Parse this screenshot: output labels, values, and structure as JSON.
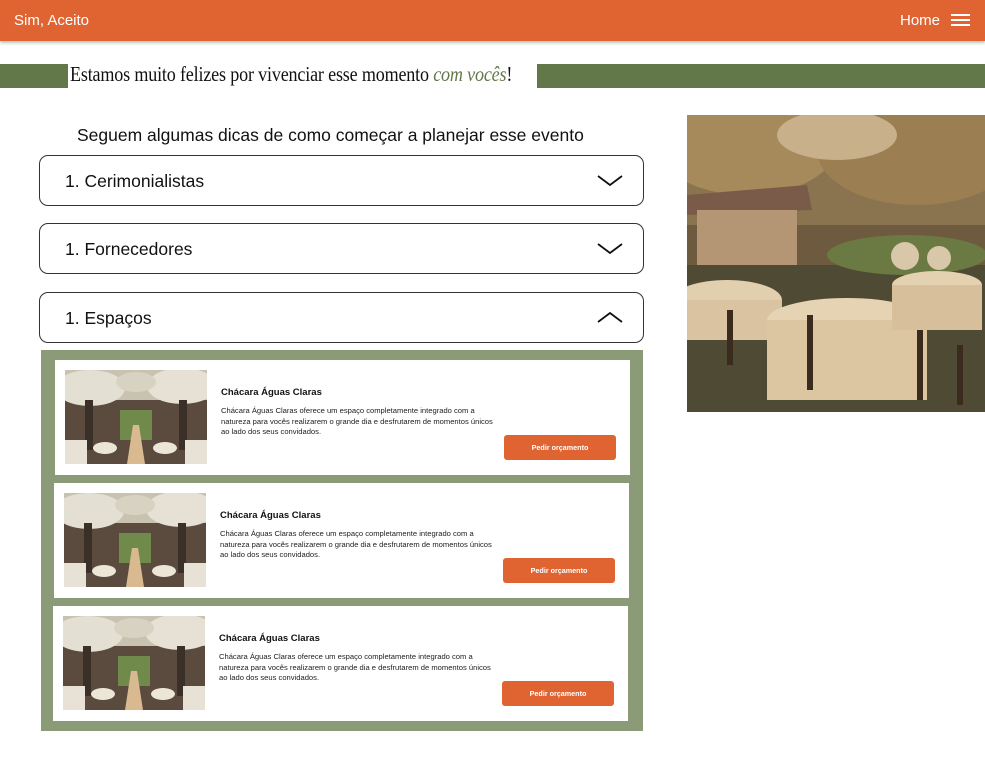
{
  "header": {
    "brand": "Sim, Aceito",
    "nav_home": "Home"
  },
  "hero": {
    "headline_main": "Estamos muito felizes por vivenciar esse momento ",
    "headline_accent": "com vocês",
    "headline_end": "!"
  },
  "intro": "Seguem algumas dicas de como começar a planejar esse evento",
  "accordions": [
    {
      "label": "1. Cerimonialistas",
      "state": "collapsed"
    },
    {
      "label": "1. Fornecedores",
      "state": "collapsed"
    },
    {
      "label": "1. Espaços",
      "state": "expanded"
    }
  ],
  "venues": [
    {
      "title": "Chácara Águas Claras",
      "description": "Chácara Águas Claras oferece um espaço completamente integrado com a natureza para vocês realizarem o grande dia e desfrutarem de momentos únicos ao lado dos seus convidados.",
      "button": "Pedir orçamento"
    },
    {
      "title": "Chácara Águas Claras",
      "description": "Chácara Águas Claras oferece um espaço completamente integrado com a natureza para vocês realizarem o grande dia e desfrutarem de momentos únicos ao lado dos seus convidados.",
      "button": "Pedir orçamento"
    },
    {
      "title": "Chácara Águas Claras",
      "description": "Chácara Águas Claras oferece um espaço completamente integrado com a natureza para vocês realizarem o grande dia e desfrutarem de momentos únicos ao lado dos seus convidados.",
      "button": "Pedir orçamento"
    }
  ],
  "colors": {
    "accent_orange": "#e06432",
    "olive": "#637849",
    "sage_panel": "#8b9a77"
  },
  "icons": {
    "menu": "hamburger-icon",
    "collapsed": "chevron-down-icon",
    "expanded": "chevron-up-icon"
  }
}
